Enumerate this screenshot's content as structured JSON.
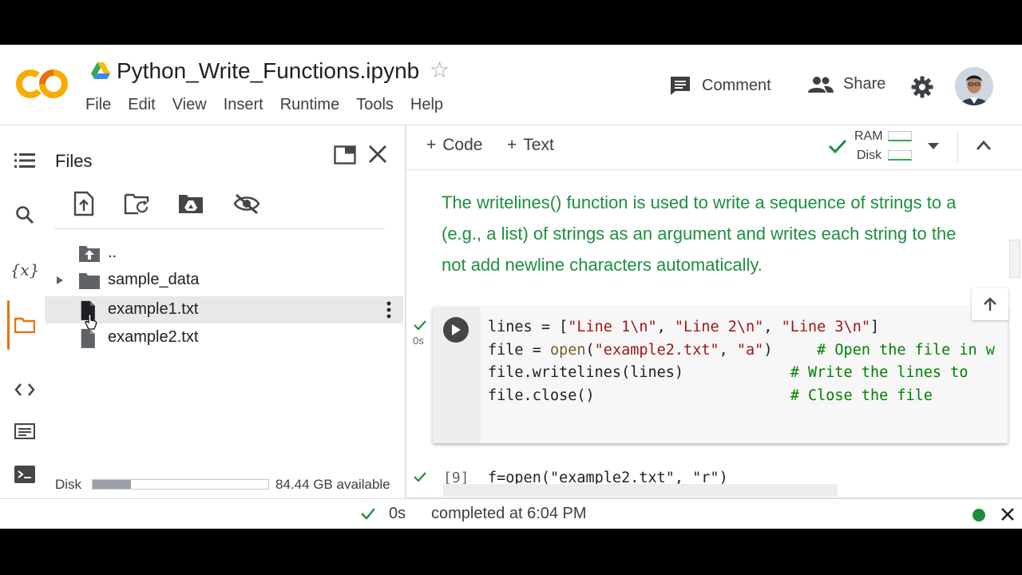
{
  "header": {
    "notebook_title": "Python_Write_Functions.ipynb",
    "menu": [
      "File",
      "Edit",
      "View",
      "Insert",
      "Runtime",
      "Tools",
      "Help"
    ],
    "comment_label": "Comment",
    "share_label": "Share"
  },
  "files_panel": {
    "title": "Files",
    "items": [
      {
        "label": "..",
        "icon": "folder-up-icon"
      },
      {
        "label": "sample_data",
        "icon": "folder-icon"
      },
      {
        "label": "example1.txt",
        "icon": "file-icon"
      },
      {
        "label": "example2.txt",
        "icon": "file-icon"
      }
    ],
    "disk_label": "Disk",
    "disk_used_fraction": 0.22,
    "disk_available": "84.44 GB available"
  },
  "toolbar": {
    "add_code": "Code",
    "add_text": "Text",
    "ram_label": "RAM",
    "disk_label": "Disk"
  },
  "notebook": {
    "markdown_lines": [
      "The writelines() function is used to write a sequence of strings to a",
      "(e.g., a list) of strings as an argument and writes each string to the",
      "not add newline characters automatically."
    ],
    "cell_exec_time": "0s",
    "next_cell_exec_count": "[9]",
    "next_cell_code": "f=open(\"example2.txt\", \"r\")"
  },
  "status": {
    "time": "0s",
    "text": "completed at 6:04 PM"
  },
  "colors": {
    "colab_orange": "#f9ab00",
    "markdown_green": "#1e8e3e",
    "string_red": "#a31515",
    "comment_green": "#008000"
  }
}
